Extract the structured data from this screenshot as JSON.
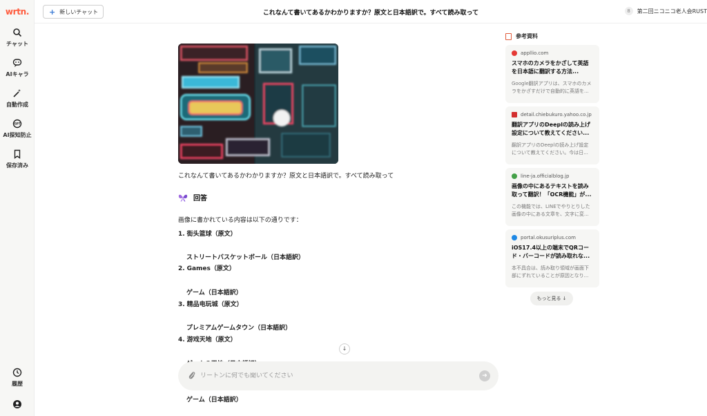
{
  "sidebar": {
    "logo": "wrtn.",
    "items": [
      {
        "label": "チャット",
        "icon": "search-icon"
      },
      {
        "label": "AIキャラ",
        "icon": "chat-bubble-icon"
      },
      {
        "label": "自動作成",
        "icon": "magic-wand-icon"
      },
      {
        "label": "AI探知防止",
        "icon": "shield-gpt-icon"
      },
      {
        "label": "保存済み",
        "icon": "bookmark-icon"
      }
    ],
    "history_label": "履歴",
    "history_icon": "clock-icon",
    "profile_icon": "user-circle-icon"
  },
  "header": {
    "new_chat_label": "新しいチャット",
    "title": "これなんて書いてあるかわかりますか？原文と日本語訳で。すべて読み取って",
    "user_name": "第二回ニコニコ老人会RUST"
  },
  "main": {
    "question": "これなんて書いてあるかわかりますか？原文と日本語訳で。すべて読み取って",
    "answer_heading": "回答",
    "answer_intro": "画像に書かれている内容は以下の通りです：",
    "items": [
      {
        "num": "1.",
        "original": "街头篮球（原文）",
        "translation": "ストリートバスケットボール（日本語訳）"
      },
      {
        "num": "2.",
        "original": "Games（原文）",
        "translation": "ゲーム（日本語訳）"
      },
      {
        "num": "3.",
        "original": "精品电玩城（原文）",
        "translation": "プレミアムゲームタウン（日本語訳）"
      },
      {
        "num": "4.",
        "original": "游戏天地（原文）",
        "translation": ""
      }
    ],
    "overflow_text": "ゲームの天地（日本語訳）",
    "last_text": "ゲーム（日本語訳）"
  },
  "input": {
    "placeholder": "リートンに何でも聞いてください"
  },
  "refs": {
    "title": "参考資料",
    "more_label": "もっと見る ↓",
    "cards": [
      {
        "domain": "appllio.com",
        "title": "スマホのカメラをかざして英語を日本語に翻訳する方法...",
        "snippet": "Google翻訳アプリは、スマホのカメラをかざすだけで自動的に英語を...",
        "color": "#e53935"
      },
      {
        "domain": "detail.chiebukuro.yahoo.co.jp",
        "title": "翻訳アプリのDeeplの読み上げ設定について教えてください...",
        "snippet": "翻訳アプリのDeeplの読み上げ設定について教えてください。今は日...",
        "color": "#d32f2f"
      },
      {
        "domain": "line-ja.officialblog.jp",
        "title": "画像の中にあるテキストを読み取って翻訳！「OCR機能」が...",
        "snippet": "この機能では、LINEでやりとりした画像の中にある文章を、文字に変...",
        "color": "#43a047"
      },
      {
        "domain": "portal.okusuriplus.com",
        "title": "iOS17.4以上の端末でQRコード・バーコードが読み取れな...",
        "snippet": "本不具合は、読み取り領域が画面下部にずれていることが原因となり...",
        "color": "#1e88e5"
      }
    ]
  },
  "colors": {
    "brand": "#ff5a3c",
    "accent": "#3a7bd5"
  }
}
